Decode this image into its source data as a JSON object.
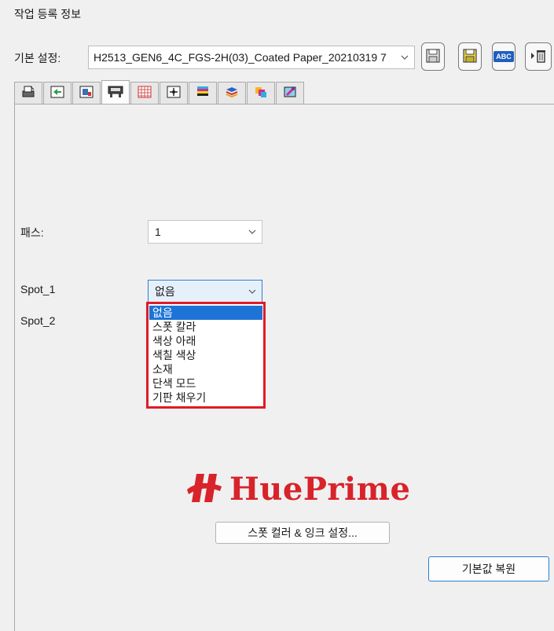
{
  "window": {
    "title": "작업 등록 정보"
  },
  "preset": {
    "label": "기본 설정:",
    "value": "H2513_GEN6_4C_FGS-2H(03)_Coated Paper_20210319 7"
  },
  "toolbar": {
    "buttons": [
      {
        "icon": "save-icon"
      },
      {
        "icon": "save-as-icon"
      },
      {
        "icon": "rename-icon",
        "text": "ABC"
      },
      {
        "icon": "delete-icon"
      }
    ]
  },
  "tabs": [
    {
      "icon": "printer-icon"
    },
    {
      "icon": "layout-icon"
    },
    {
      "icon": "image-icon"
    },
    {
      "icon": "print-mode-icon",
      "active": true
    },
    {
      "icon": "grid-icon"
    },
    {
      "icon": "position-icon"
    },
    {
      "icon": "color-bars-icon"
    },
    {
      "icon": "media-icon"
    },
    {
      "icon": "color-management-icon"
    },
    {
      "icon": "eyedropper-icon"
    }
  ],
  "pass": {
    "label": "패스:",
    "value": "1"
  },
  "spot1": {
    "label": "Spot_1",
    "value": "없음",
    "options": [
      "없음",
      "스폿 칼라",
      "색상 아래",
      "색칠 색상",
      "소재",
      "단색 모드",
      "기판 채우기"
    ]
  },
  "spot2": {
    "label": "Spot_2"
  },
  "logo": {
    "text": "HuePrime",
    "color": "#d8232a"
  },
  "buttons": {
    "spot_ink_settings": "스폿 컬러 & 잉크 설정...",
    "restore_defaults": "기본값 복원"
  },
  "colors": {
    "highlight": "#e01b24",
    "selection": "#1e73d6",
    "focus": "#2a7fd4"
  }
}
